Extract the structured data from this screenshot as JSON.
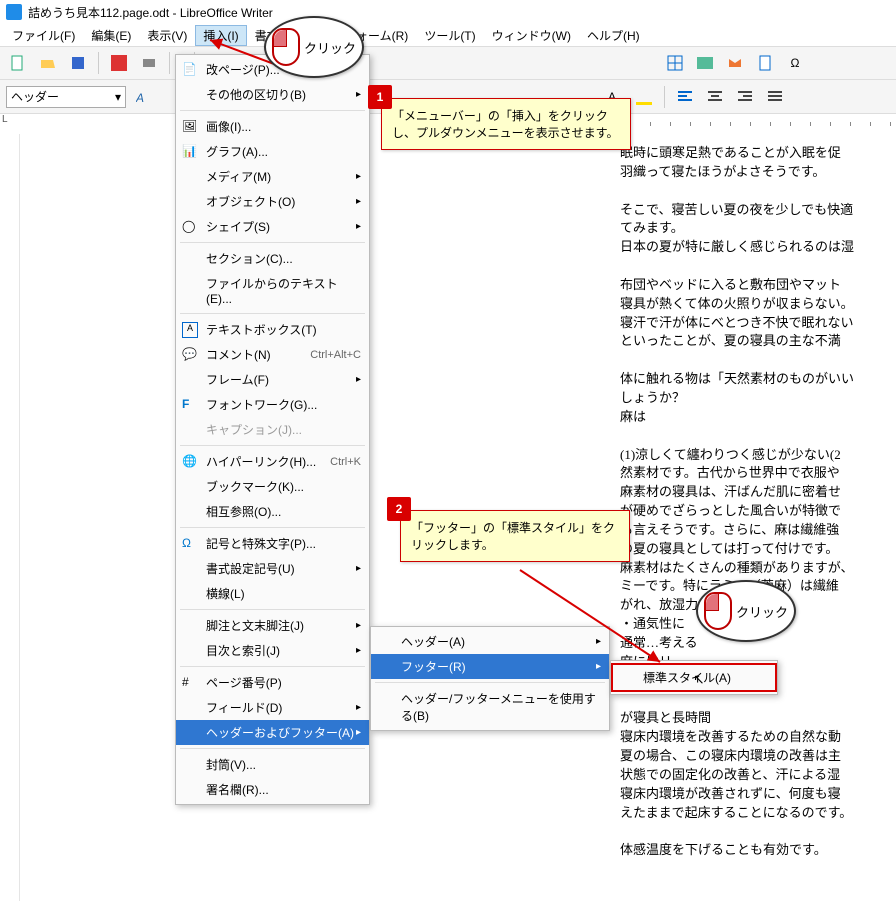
{
  "title": "詰めうち見本112.page.odt - LibreOffice Writer",
  "menus": {
    "file": "ファイル(F)",
    "edit": "編集(E)",
    "view": "表示(V)",
    "insert": "挿入(I)",
    "format": "書式(O)",
    "form_ctl": "フォーム(R)",
    "tools": "ツール(T)",
    "window": "ウィンドウ(W)",
    "help": "ヘルプ(H)"
  },
  "style_combo": "ヘッダー",
  "insert_menu": {
    "page_break": "改ページ(P)...",
    "other_breaks": "その他の区切り(B)",
    "image": "画像(I)...",
    "chart": "グラフ(A)...",
    "media": "メディア(M)",
    "object": "オブジェクト(O)",
    "shape": "シェイプ(S)",
    "section": "セクション(C)...",
    "text_from_file": "ファイルからのテキスト(E)...",
    "textbox": "テキストボックス(T)",
    "comment": "コメント(N)",
    "comment_shortcut": "Ctrl+Alt+C",
    "frame": "フレーム(F)",
    "fontwork": "フォントワーク(G)...",
    "caption": "キャプション(J)...",
    "hyperlink": "ハイパーリンク(H)...",
    "hyperlink_shortcut": "Ctrl+K",
    "bookmark": "ブックマーク(K)...",
    "crossref": "相互参照(O)...",
    "special_char": "記号と特殊文字(P)...",
    "formatting_mark": "書式設定記号(U)",
    "horiz_line": "横線(L)",
    "footnote": "脚注と文末脚注(J)",
    "toc_index": "目次と索引(J)",
    "page_number": "ページ番号(P)",
    "field": "フィールド(D)",
    "header_footer": "ヘッダーおよびフッター(A)",
    "envelope": "封筒(V)...",
    "signature": "署名欄(R)..."
  },
  "submenu_hf": {
    "header": "ヘッダー(A)",
    "footer": "フッター(R)",
    "use_menu": "ヘッダー/フッターメニューを使用する(B)"
  },
  "submenu_footer": {
    "default_style": "標準スタイル(A)"
  },
  "callout1": "「メニューバー」の「挿入」をクリックし、プルダウンメニューを表示させます。",
  "callout2": "「フッター」の「標準スタイル」をクリックします。",
  "click_label": "クリック",
  "doc_lines": "眠時に頭寒足熱であることが入眠を促\n羽織って寝たほうがよさそうです。\n\nそこで、寝苦しい夏の夜を少しでも快適\nてみます。\n日本の夏が特に厳しく感じられるのは湿\n\n布団やベッドに入ると敷布団やマット\n寝具が熱くて体の火照りが収まらない。\n寝汗で汗が体にべとつき不快で眠れない\nといったことが、夏の寝具の主な不満\n\n体に触れる物は「天然素材のものがいい\nしょうか？\n麻は\n\n(1)涼しくて纏わりつく感じが少ない(2\n然素材です。古代から世界中で衣服や\n麻素材の寝具は、汗ばんだ肌に密着せ\nが硬めでざらっとした風合いが特徴で\nも言えそうです。さらに、麻は繊維強\nの夏の寝具としては打って付けです。\n麻素材はたくさんの種類がありますが、\nミーです。特にラミー（苧麻）は繊維\nがれ、放湿力も\n・通気性に\n通常…考える\n麻にはリ\nー素材があり\n\nが寝具と長時間\n寝床内環境を改善するための自然な動\n夏の場合、この寝床内環境の改善は主\n状態での固定化の改善と、汗による湿\n寝床内環境が改善されずに、何度も寝\nえたままで起床することになるのです。\n\n体感温度を下げることも有効です。"
}
